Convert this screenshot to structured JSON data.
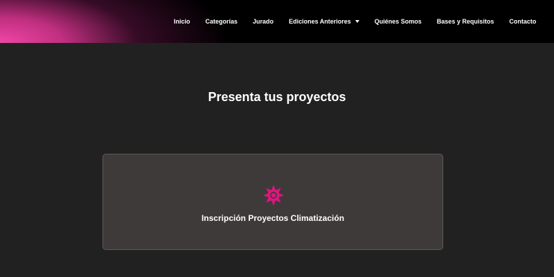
{
  "header": {
    "nav": [
      {
        "label": "Inicio"
      },
      {
        "label": "Categorías"
      },
      {
        "label": "Jurado"
      },
      {
        "label": "Ediciones Anteriores",
        "has_dropdown": true
      },
      {
        "label": "Quiénes Somos"
      },
      {
        "label": "Bases y Requisitos"
      },
      {
        "label": "Contacto"
      }
    ],
    "gradient_color": "#f04aa8",
    "background": "#000000"
  },
  "main": {
    "title": "Presenta tus proyectos",
    "background": "#212121",
    "card": {
      "icon": "sun-icon",
      "icon_color": "#e0157f",
      "title": "Inscripción Proyectos Climatización",
      "background": "#3e3a3a"
    }
  }
}
